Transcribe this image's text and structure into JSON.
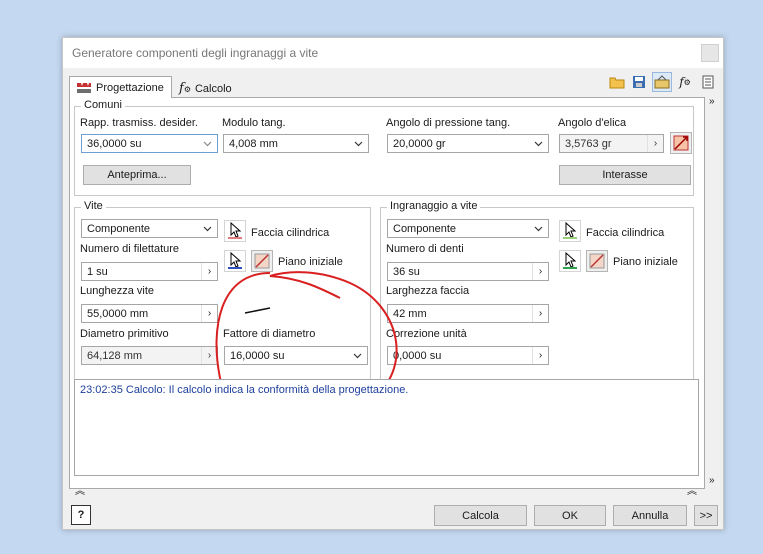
{
  "window": {
    "title": "Generatore componenti degli ingranaggi a vite"
  },
  "tabs": [
    {
      "label": "Progettazione"
    },
    {
      "label": "Calcolo"
    }
  ],
  "comuni": {
    "group_label": "Comuni",
    "rapp_label": "Rapp. trasmiss. desider.",
    "rapp_value": "36,0000 su",
    "modulo_label": "Modulo tang.",
    "modulo_value": "4,008 mm",
    "angolo_pressione_label": "Angolo di pressione tang.",
    "angolo_pressione_value": "20,0000 gr",
    "angolo_elica_label": "Angolo d'elica",
    "angolo_elica_value": "3,5763 gr",
    "anteprima_button": "Anteprima...",
    "interasse_button": "Interasse"
  },
  "vite": {
    "group_label": "Vite",
    "componente_value": "Componente",
    "faccia_label": "Faccia cilindrica",
    "piano_label": "Piano iniziale",
    "filettature_label": "Numero di filettature",
    "filettature_value": "1 su",
    "lunghezza_label": "Lunghezza vite",
    "lunghezza_value": "55,0000 mm",
    "diametro_label": "Diametro primitivo",
    "diametro_value": "64,128 mm",
    "fattore_label": "Fattore di diametro",
    "fattore_value": "16,0000 su"
  },
  "ingranaggio": {
    "group_label": "Ingranaggio a vite",
    "componente_value": "Componente",
    "faccia_label": "Faccia cilindrica",
    "piano_label": "Piano iniziale",
    "denti_label": "Numero di denti",
    "denti_value": "36 su",
    "larghezza_label": "Larghezza faccia",
    "larghezza_value": "42 mm",
    "correzione_label": "Correzione unità",
    "correzione_value": "0,0000 su"
  },
  "messages": {
    "line1": "23:02:35 Calcolo: Il calcolo indica la conformità della progettazione."
  },
  "footer": {
    "calcola": "Calcola",
    "ok": "OK",
    "annulla": "Annulla",
    "more": ">>"
  }
}
